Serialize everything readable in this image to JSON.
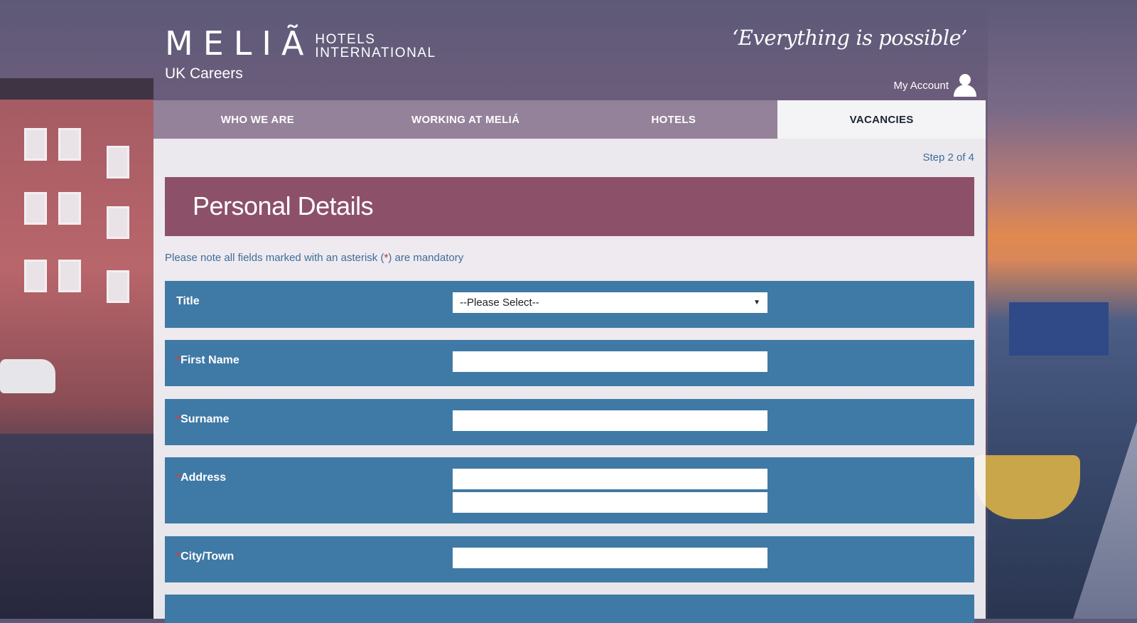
{
  "brand": {
    "logo_main": "MELIÃ",
    "logo_sub_line1": "HOTELS",
    "logo_sub_line2": "INTERNATIONAL",
    "careers": "UK Careers",
    "tagline": "‘Everything is possible’"
  },
  "account": {
    "label": "My Account",
    "icon": "user-icon"
  },
  "nav": {
    "items": [
      {
        "label": "WHO WE ARE",
        "active": false
      },
      {
        "label": "WORKING AT MELIÁ",
        "active": false
      },
      {
        "label": "HOTELS",
        "active": false
      },
      {
        "label": "VACANCIES",
        "active": true
      }
    ]
  },
  "progress": {
    "step_text": "Step 2 of 4"
  },
  "section": {
    "title": "Personal Details"
  },
  "note": {
    "before": "Please note all fields marked with an asterisk (",
    "star": "*",
    "after": ") are mandatory"
  },
  "form": {
    "title": {
      "label": "Title",
      "required": false,
      "value": "--Please Select--"
    },
    "first_name": {
      "label": "First Name",
      "required": true,
      "value": ""
    },
    "surname": {
      "label": "Surname",
      "required": true,
      "value": ""
    },
    "address": {
      "label": "Address",
      "required": true,
      "line1": "",
      "line2": ""
    },
    "city": {
      "label": "City/Town",
      "required": true,
      "value": ""
    },
    "required_marker": "*"
  },
  "colors": {
    "section_header": "#8c5069",
    "form_row": "#3f79a5",
    "link_text": "#3f6d98",
    "required": "#e23a3a"
  }
}
